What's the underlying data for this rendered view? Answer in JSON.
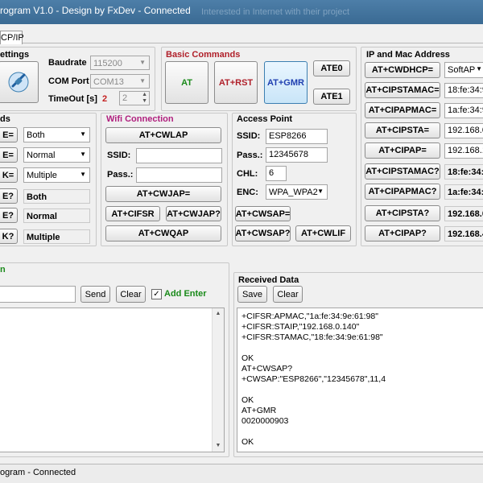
{
  "window": {
    "title": "rogram V1.0 - Design by FxDev - Connected",
    "ghost_title": "Interested in Internet with their project"
  },
  "tabs": [
    {
      "label": "CP/IP"
    }
  ],
  "settings": {
    "title": "ettings",
    "baudrate_label": "Baudrate",
    "baudrate_value": "115200",
    "comport_label": "COM Port",
    "comport_value": "COM13",
    "timeout_label": "TimeOut [s]",
    "timeout_red": "2",
    "timeout_value": "2"
  },
  "basic": {
    "title": "Basic Commands",
    "at": "AT",
    "at_rst": "AT+RST",
    "at_gmr": "AT+GMR",
    "ate0": "ATE0",
    "ate1": "ATE1"
  },
  "ipmac": {
    "title": "IP and Mac Address",
    "buttons": [
      "AT+CWDHCP=",
      "AT+CIPSTAMAC=",
      "AT+CIPAPMAC=",
      "AT+CIPSTA=",
      "AT+CIPAP=",
      "AT+CIPSTAMAC?",
      "AT+CIPAPMAC?",
      "AT+CIPSTA?",
      "AT+CIPAP?"
    ],
    "values": [
      "SoftAP",
      "18:fe:34:9",
      "1a:fe:34:9",
      "192.168.0.",
      "192.168.1.",
      "18:fe:34:9",
      "1a:fe:34:9",
      "192.168.0.",
      "192.168.4."
    ]
  },
  "mode": {
    "title": "ds",
    "btns": [
      "E=",
      "E=",
      "K=",
      "E?",
      "E?",
      "K?"
    ],
    "combos": [
      "Both",
      "Normal",
      "Multiple"
    ],
    "readonly": [
      "Both",
      "Normal",
      "Multiple"
    ]
  },
  "wifi": {
    "title": "Wifi Connection",
    "cwlap": "AT+CWLAP",
    "ssid_label": "SSID:",
    "pass_label": "Pass.:",
    "cwjap_set": "AT+CWJAP=",
    "cifsr": "AT+CIFSR",
    "cwjap_q": "AT+CWJAP?",
    "cwqap": "AT+CWQAP"
  },
  "ap": {
    "title": "Access Point",
    "ssid_label": "SSID:",
    "ssid_value": "ESP8266",
    "pass_label": "Pass.:",
    "pass_value": "12345678",
    "chl_label": "CHL:",
    "chl_value": "6",
    "enc_label": "ENC:",
    "enc_value": "WPA_WPA2",
    "cwsap_set": "AT+CWSAP=",
    "cwsap_q": "AT+CWSAP?",
    "cwlif": "AT+CWLIF"
  },
  "send": {
    "title": "n",
    "send": "Send",
    "clear": "Clear",
    "add_enter": "Add Enter",
    "add_enter_checked": "✓"
  },
  "received": {
    "title": "Received Data",
    "save": "Save",
    "clear": "Clear",
    "lines": [
      "+CIFSR:APMAC,\"1a:fe:34:9e:61:98\"",
      "+CIFSR:STAIP,\"192.168.0.140\"",
      "+CIFSR:STAMAC,\"18:fe:34:9e:61:98\"",
      "",
      "OK",
      "AT+CWSAP?",
      "+CWSAP:\"ESP8266\",\"12345678\",11,4",
      "",
      "OK",
      "AT+GMR",
      "0020000903",
      "",
      "OK"
    ]
  },
  "status": {
    "text": "ogram - Connected"
  }
}
